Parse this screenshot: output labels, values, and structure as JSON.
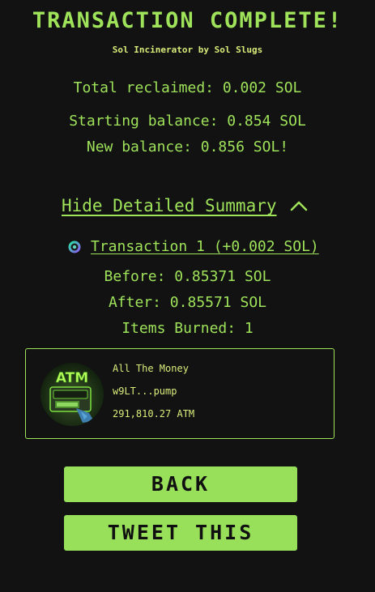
{
  "header": {
    "title": "TRANSACTION COMPLETE!",
    "subtitle": "Sol Incinerator by Sol Slugs"
  },
  "summary": {
    "total_reclaimed": "Total reclaimed: 0.002 SOL",
    "starting_balance": "Starting balance: 0.854 SOL",
    "new_balance": "New balance: 0.856 SOL!"
  },
  "details": {
    "toggle_label": "Hide Detailed Summary",
    "toggle_icon": "chevron-up-icon",
    "transactions": [
      {
        "label": "Transaction 1 (+0.002 SOL)",
        "before": "Before: 0.85371 SOL",
        "after": "After: 0.85571 SOL",
        "items_burned": "Items Burned: 1",
        "tokens": [
          {
            "name": "All The Money",
            "mint": "w9LT...pump",
            "amount": "291,810.27 ATM",
            "image_text": "ATM"
          }
        ]
      }
    ]
  },
  "actions": {
    "back_label": "BACK",
    "tweet_label": "TWEET THIS"
  },
  "colors": {
    "background": "#121212",
    "accent": "#9fe35a",
    "button": "#99e05a",
    "button_text": "#101010"
  }
}
